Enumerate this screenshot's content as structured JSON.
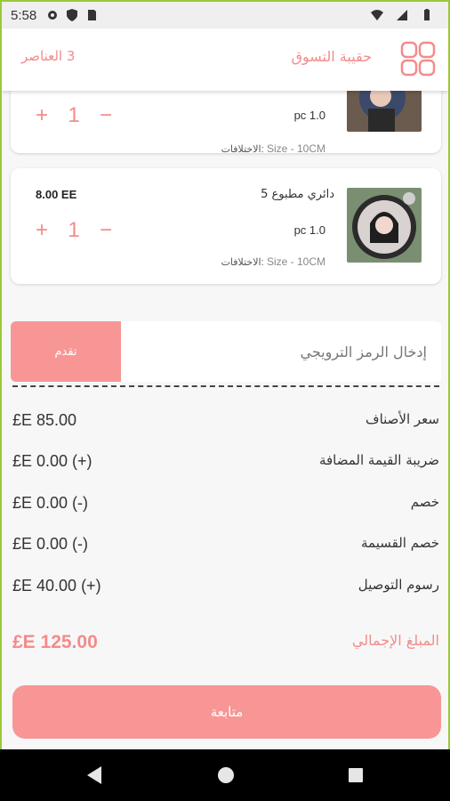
{
  "status_bar": {
    "time": "5:58"
  },
  "header": {
    "title": "حقيبة التسوق",
    "items_count": "3 العناصر"
  },
  "cart": {
    "items": [
      {
        "name": "",
        "price": "",
        "qty_unit": "pc 1.0",
        "variants_label": "الاختلافات:",
        "variants_value": "Size - 10CM",
        "quantity": "1"
      },
      {
        "name": "دائري مطبوع 5",
        "price": "8.00 EE",
        "qty_unit": "pc 1.0",
        "variants_label": "الاختلافات:",
        "variants_value": "Size - 10CM",
        "quantity": "1"
      }
    ]
  },
  "promo": {
    "placeholder": "إدخال الرمز الترويجي",
    "apply_label": "تقدم"
  },
  "summary": {
    "rows": [
      {
        "label": "سعر الأصناف",
        "value": "£E 85.00"
      },
      {
        "label": "ضريبة القيمة المضافة",
        "value": "£E 0.00 (+)"
      },
      {
        "label": "خصم",
        "value": "£E 0.00 (-)"
      },
      {
        "label": "خصم القسيمة",
        "value": "£E 0.00 (-)"
      },
      {
        "label": "رسوم التوصيل",
        "value": "£E 40.00 (+)"
      }
    ],
    "total_label": "المبلغ الإجمالي",
    "total_value": "£E 125.00"
  },
  "continue_label": "متابعة",
  "colors": {
    "accent": "#f89696",
    "accent_text": "#f48b8b",
    "frame": "#9bc93a"
  }
}
